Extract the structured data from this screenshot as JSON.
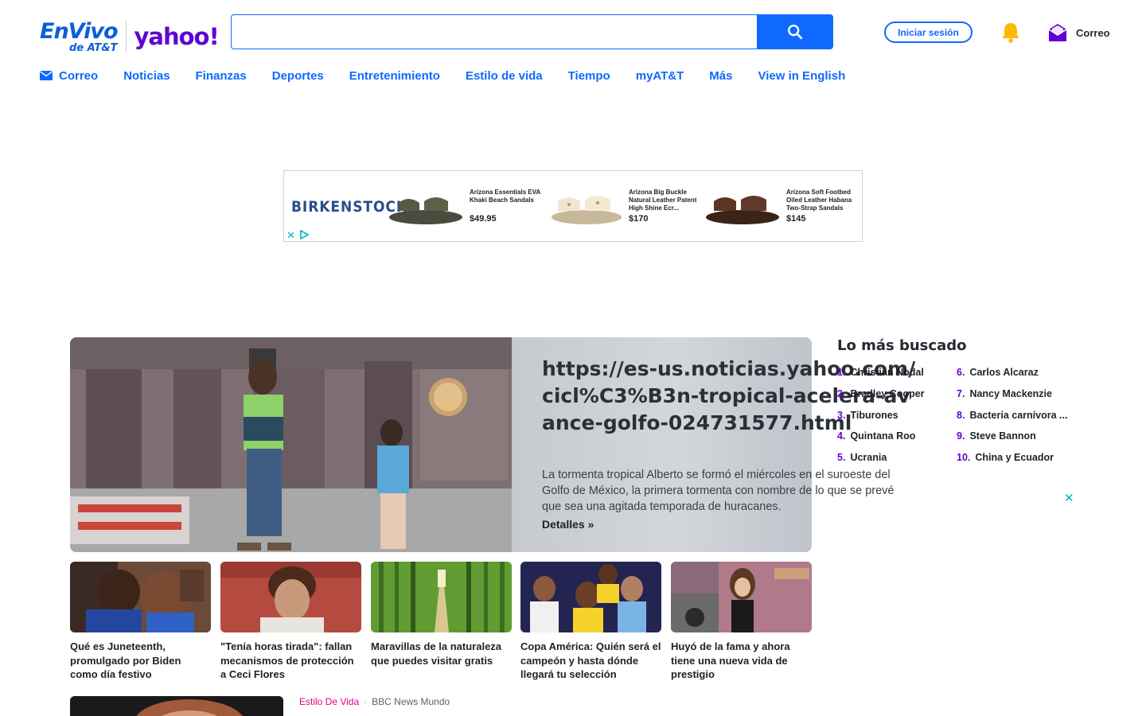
{
  "logo": {
    "envivo": "EnVivo",
    "att": "de AT&T",
    "yahoo": "yahoo!"
  },
  "search": {
    "value": "",
    "placeholder": "",
    "icon": "search-icon"
  },
  "header": {
    "signin_label": "Iniciar sesión",
    "mail_label": "Correo"
  },
  "nav": {
    "items": [
      {
        "label": "Correo",
        "icon": "mail-icon"
      },
      {
        "label": "Noticias"
      },
      {
        "label": "Finanzas"
      },
      {
        "label": "Deportes"
      },
      {
        "label": "Entretenimiento"
      },
      {
        "label": "Estilo de vida"
      },
      {
        "label": "Tiempo"
      },
      {
        "label": "myAT&T"
      },
      {
        "label": "Más"
      },
      {
        "label": "View in English"
      }
    ]
  },
  "ad": {
    "brand": "BIRKENSTOCK",
    "products": [
      {
        "name": "Arizona Essentials EVA Khaki Beach Sandals",
        "price": "$49.95"
      },
      {
        "name": "Arizona Big Buckle Natural Leather Patent High Shine Ecr...",
        "price": "$170"
      },
      {
        "name": "Arizona Soft Footbed Oiled Leather Habana Two-Strap Sandals",
        "price": "$145"
      }
    ]
  },
  "hero": {
    "title": "https://es-us.noticias.yahoo.com/cicl%C3%B3n-tropical-acelera-avance-golfo-024731577.html",
    "description": "La tormenta tropical Alberto se formó el miércoles en el suroeste del Golfo de México, la primera tormenta con nombre de lo que se prevé que sea una agitada temporada de huracanes.",
    "more": "Detalles »"
  },
  "trending": {
    "title": "Lo más buscado",
    "items": [
      {
        "n": "1.",
        "label": "Christian Nodal"
      },
      {
        "n": "2.",
        "label": "Bradley Cooper"
      },
      {
        "n": "3.",
        "label": "Tiburones"
      },
      {
        "n": "4.",
        "label": "Quintana Roo"
      },
      {
        "n": "5.",
        "label": "Ucrania"
      },
      {
        "n": "6.",
        "label": "Carlos Alcaraz"
      },
      {
        "n": "7.",
        "label": "Nancy Mackenzie"
      },
      {
        "n": "8.",
        "label": "Bacteria carnívora ..."
      },
      {
        "n": "9.",
        "label": "Steve Bannon"
      },
      {
        "n": "10.",
        "label": "China y Ecuador"
      }
    ]
  },
  "cards": [
    {
      "title": "Qué es Juneteenth, promulgado por Biden como día festivo"
    },
    {
      "title": "\"Tenía horas tirada\": fallan mecanismos de protección a Ceci Flores"
    },
    {
      "title": "Maravillas de la naturaleza que puedes visitar gratis"
    },
    {
      "title": "Copa América: Quién será el campeón y hasta dónde llegará tu selección"
    },
    {
      "title": "Huyó de la fama y ahora tiene una nueva vida de prestigio"
    }
  ],
  "bottom": {
    "category": "Estilo De Vida",
    "source": "BBC News Mundo"
  },
  "colors": {
    "accent": "#0f69ff",
    "yahoo_purple": "#6001d2",
    "category_pink": "#e0028a",
    "ad_close": "#00aecd"
  }
}
